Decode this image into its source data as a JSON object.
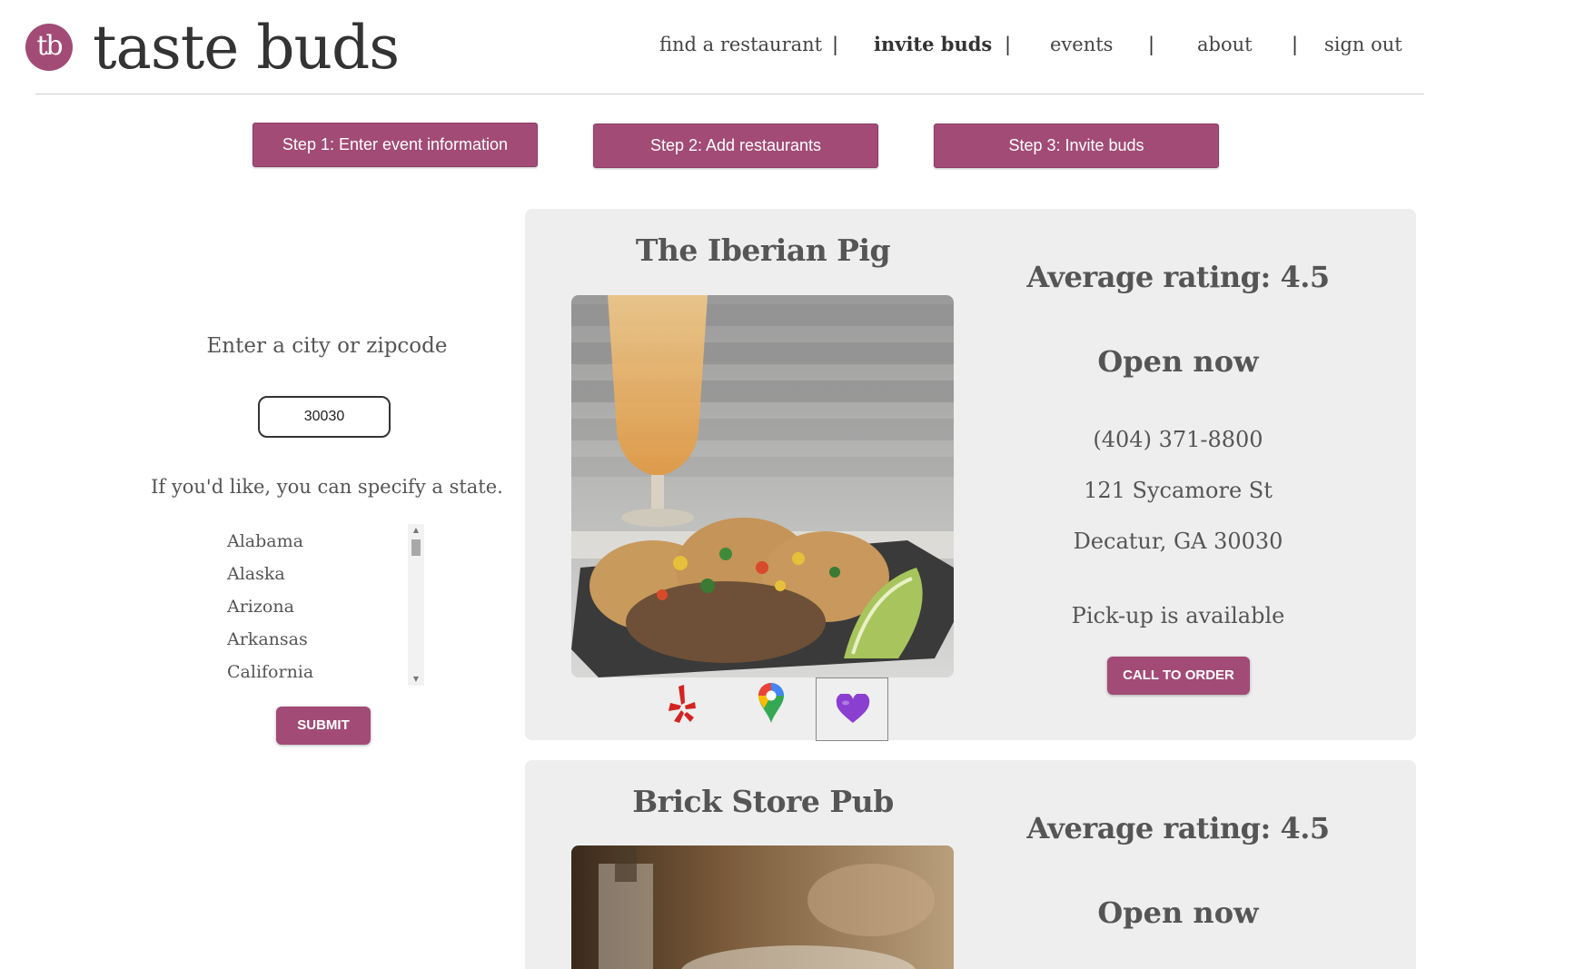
{
  "brand": {
    "logo_initials": "tb",
    "name": "taste buds",
    "accent_color": "#a24b76"
  },
  "nav": {
    "items": [
      {
        "label": "find a restaurant",
        "active": false
      },
      {
        "label": "invite buds",
        "active": true
      },
      {
        "label": "events",
        "active": false
      },
      {
        "label": "about",
        "active": false
      },
      {
        "label": "sign out",
        "active": false
      }
    ],
    "separator": "|"
  },
  "steps": [
    {
      "label": "Step 1: Enter event information"
    },
    {
      "label": "Step 2: Add restaurants"
    },
    {
      "label": "Step 3: Invite buds"
    }
  ],
  "search": {
    "city_prompt": "Enter a city or zipcode",
    "zip_value": "30030",
    "state_prompt": "If you'd like, you can specify a state.",
    "states_visible": [
      "Alabama",
      "Alaska",
      "Arizona",
      "Arkansas",
      "California"
    ],
    "submit_label": "SUBMIT"
  },
  "restaurants": [
    {
      "name": "The Iberian Pig",
      "average_rating": "Average rating: 4.5",
      "status": "Open now",
      "phone": "(404) 371-8800",
      "address_line1": "121 Sycamore St",
      "address_line2": "Decatur, GA 30030",
      "pickup": "Pick-up is available",
      "call_label": "CALL TO ORDER",
      "icons": [
        "yelp-icon",
        "google-maps-icon",
        "purple-heart-icon"
      ]
    },
    {
      "name": "Brick Store Pub",
      "average_rating": "Average rating: 4.5",
      "status": "Open now"
    }
  ]
}
